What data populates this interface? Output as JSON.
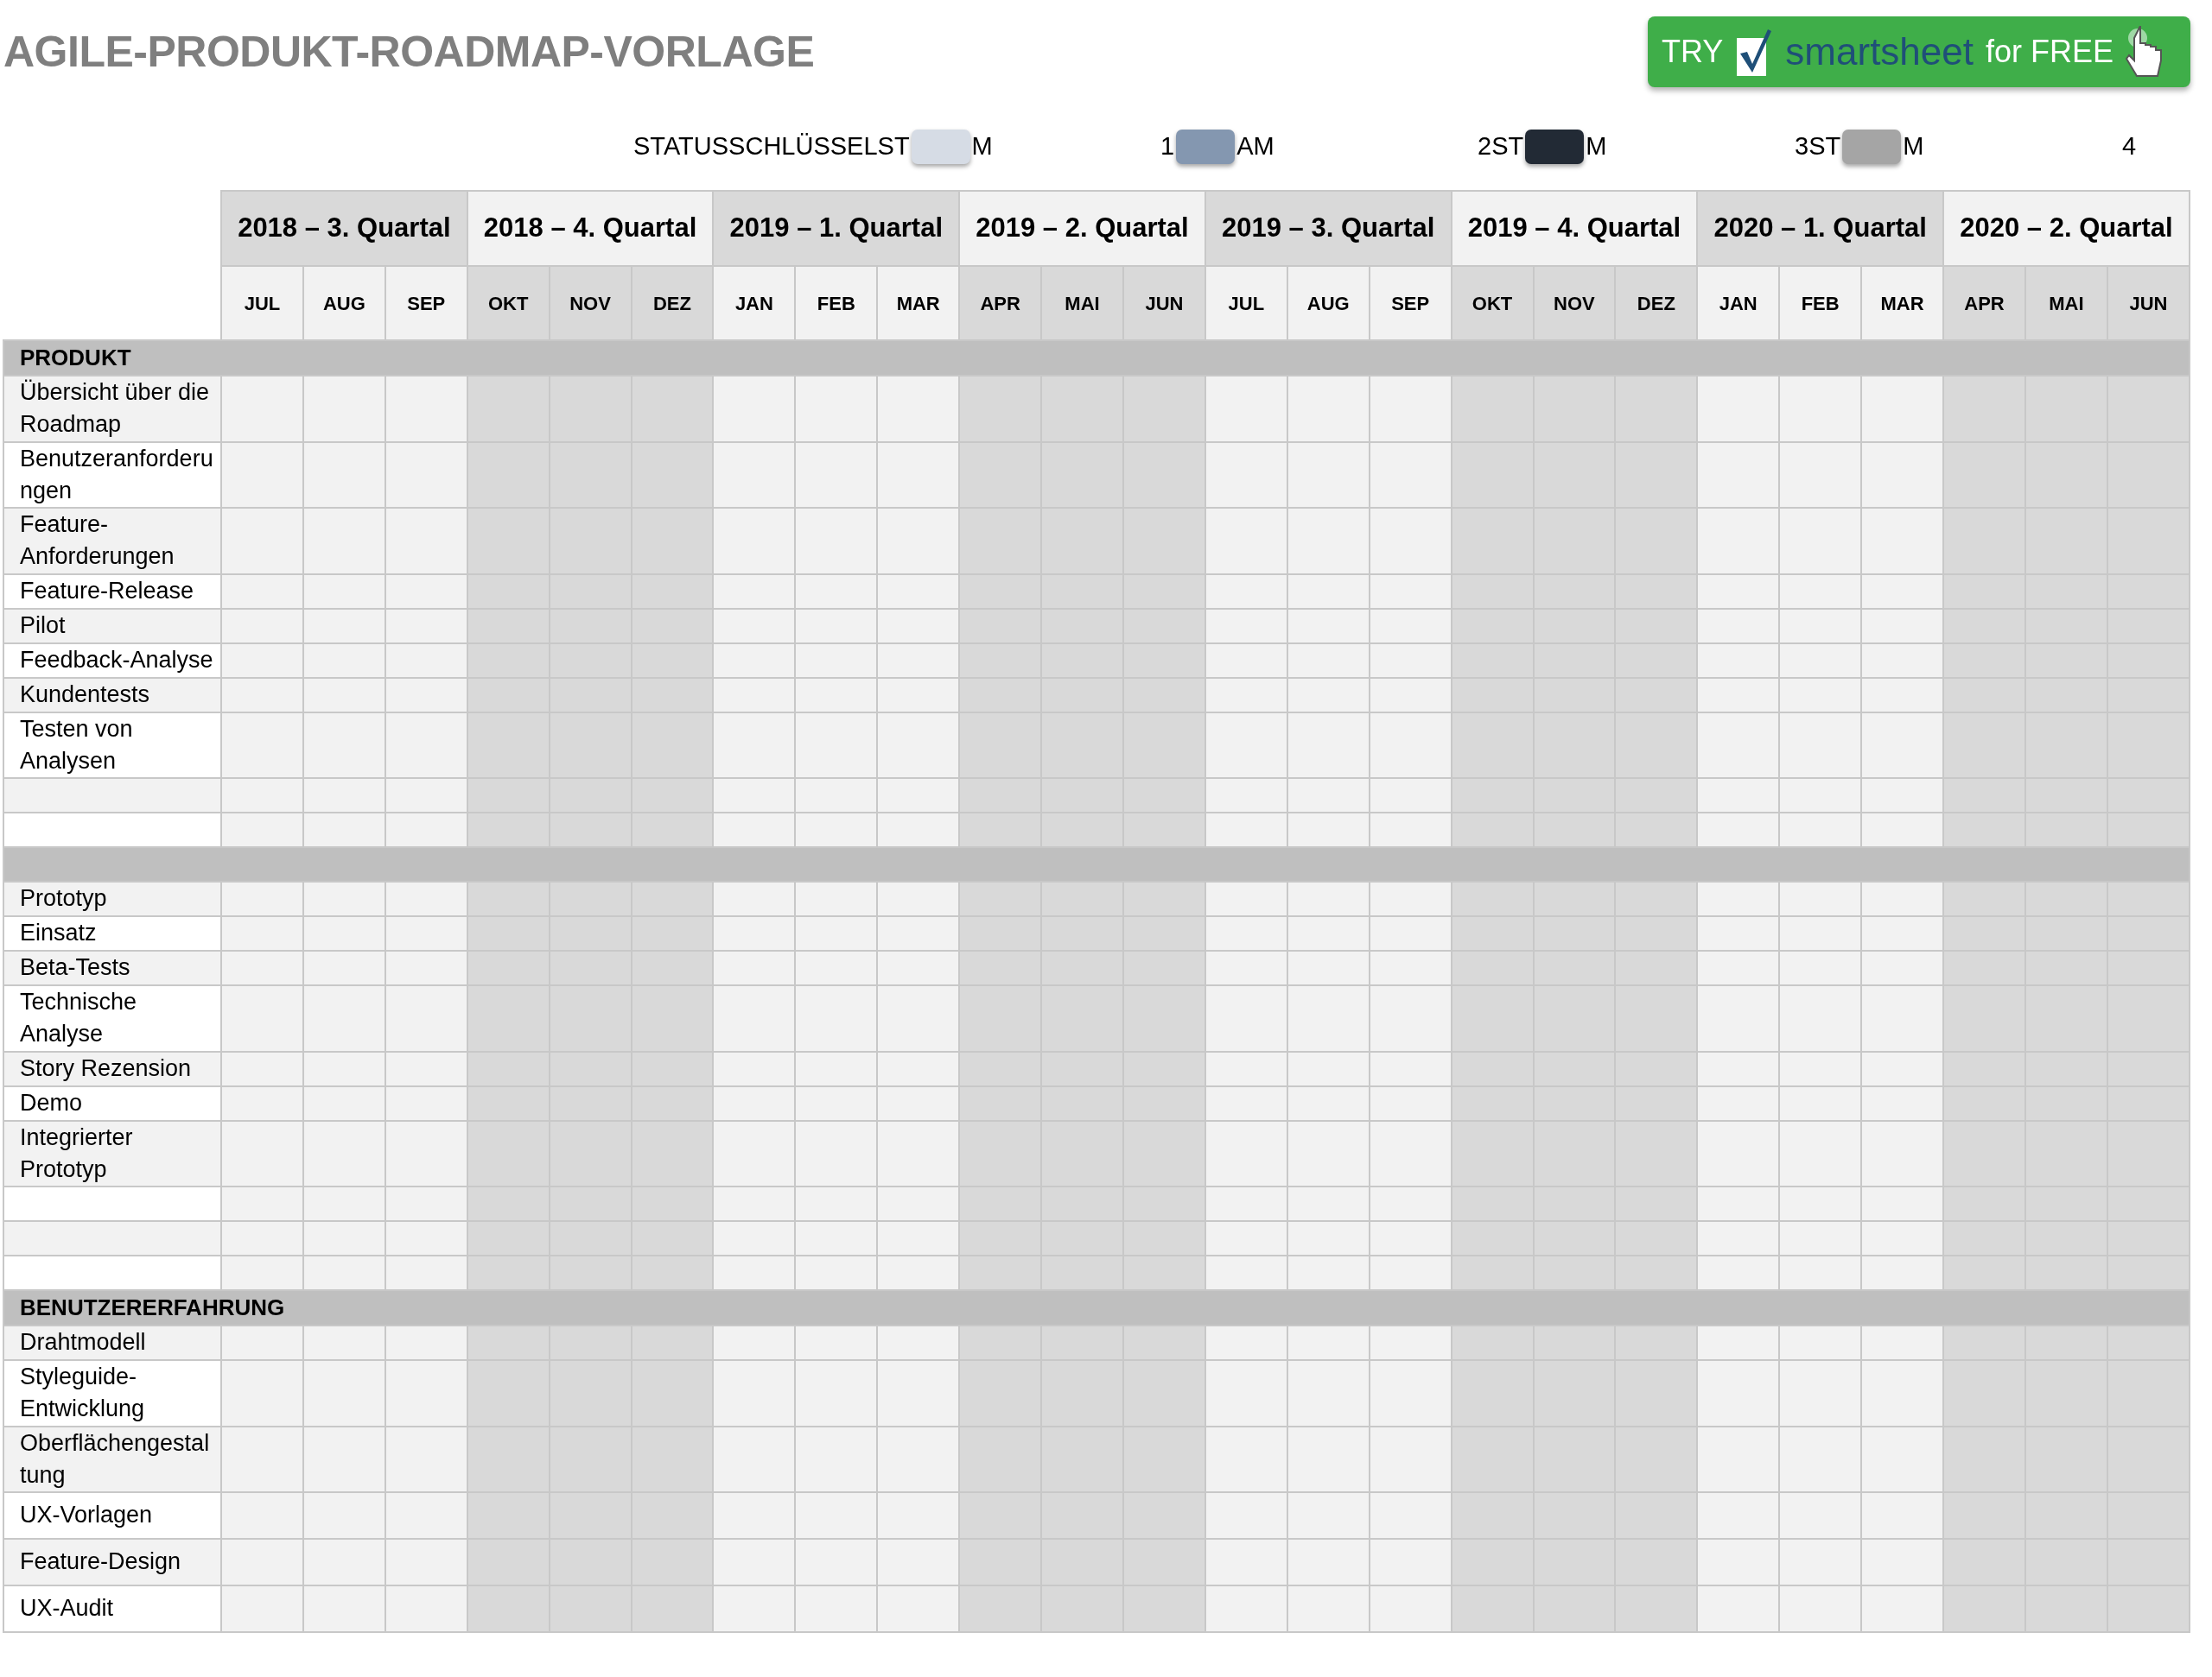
{
  "title": "AGILE-PRODUKT-ROADMAP-VORLAGE",
  "legend": {
    "items": [
      {
        "before": "STATUSSCHLÜSSELST",
        "color": "#d6dce5",
        "after": "M"
      },
      {
        "before": "1",
        "color": "#8497b0",
        "after": "AM"
      },
      {
        "before": "2ST",
        "color": "#222a35",
        "after": "M"
      },
      {
        "before": "3ST",
        "color": "#a5a5a5",
        "after": "M"
      },
      {
        "before": "4"
      }
    ]
  },
  "promo": {
    "try": "TRY",
    "brand": "smartsheet",
    "offer": "for FREE"
  },
  "quarters": [
    {
      "label": "2018 – 3. Quartal",
      "months": [
        "JUL",
        "AUG",
        "SEP"
      ]
    },
    {
      "label": "2018 – 4. Quartal",
      "months": [
        "OKT",
        "NOV",
        "DEZ"
      ]
    },
    {
      "label": "2019 – 1. Quartal",
      "months": [
        "JAN",
        "FEB",
        "MAR"
      ]
    },
    {
      "label": "2019 – 2. Quartal",
      "months": [
        "APR",
        "MAI",
        "JUN"
      ]
    },
    {
      "label": "2019 – 3. Quartal",
      "months": [
        "JUL",
        "AUG",
        "SEP"
      ]
    },
    {
      "label": "2019 – 4. Quartal",
      "months": [
        "OKT",
        "NOV",
        "DEZ"
      ]
    },
    {
      "label": "2020 – 1. Quartal",
      "months": [
        "JAN",
        "FEB",
        "MAR"
      ]
    },
    {
      "label": "2020 – 2. Quartal",
      "months": [
        "APR",
        "MAI",
        "JUN"
      ]
    }
  ],
  "sections": [
    {
      "title": "PRODUKT",
      "rows": [
        {
          "kind": "task",
          "label": "Übersicht über die Roadmap"
        },
        {
          "kind": "task",
          "label": "Benutzeranforderungen"
        },
        {
          "kind": "task",
          "label": "Feature-Anforderungen"
        },
        {
          "kind": "task",
          "label": "Feature-Release"
        },
        {
          "kind": "task",
          "label": "Pilot"
        },
        {
          "kind": "task",
          "label": "Feedback-Analyse"
        },
        {
          "kind": "task",
          "label": "Kundentests"
        },
        {
          "kind": "task",
          "label": "Testen von Analysen"
        },
        {
          "kind": "blank"
        },
        {
          "kind": "blank"
        }
      ]
    },
    {
      "rows": [
        {
          "kind": "task",
          "label": "Prototyp"
        },
        {
          "kind": "task",
          "label": "Einsatz"
        },
        {
          "kind": "task",
          "label": "Beta-Tests"
        },
        {
          "kind": "task",
          "label": "Technische Analyse"
        },
        {
          "kind": "task",
          "label": "Story Rezension"
        },
        {
          "kind": "task",
          "label": "Demo"
        },
        {
          "kind": "task",
          "label": "Integrierter Prototyp"
        },
        {
          "kind": "blank"
        },
        {
          "kind": "blank"
        },
        {
          "kind": "blank"
        }
      ]
    },
    {
      "title": "BENUTZERERFAHRUNG",
      "rows": [
        {
          "kind": "task",
          "label": "Drahtmodell"
        },
        {
          "kind": "task",
          "label": "Styleguide-Entwicklung"
        },
        {
          "kind": "task",
          "label": "Oberflächengestaltung"
        },
        {
          "kind": "tall",
          "label": "UX-Vorlagen"
        },
        {
          "kind": "tall",
          "label": "Feature-Design"
        },
        {
          "kind": "tall",
          "label": "UX-Audit"
        }
      ]
    }
  ]
}
